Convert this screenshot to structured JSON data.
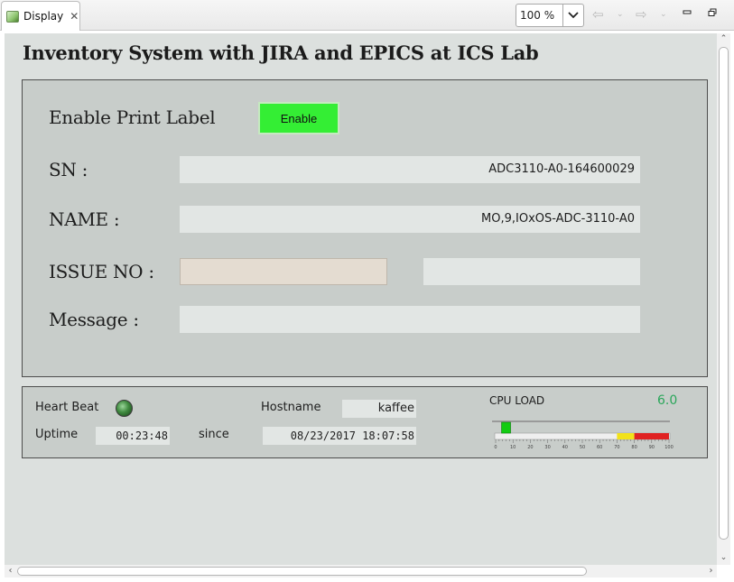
{
  "tab": {
    "title": "Display"
  },
  "toolbar": {
    "zoom": "100 %"
  },
  "display": {
    "title": "Inventory System with JIRA and EPICS at ICS Lab",
    "enable_print_label": "Enable Print Label",
    "enable_button": "Enable",
    "sn_label": "SN :",
    "sn_value": "ADC3110-A0-164600029",
    "name_label": "NAME :",
    "name_value": "MO,9,IOxOS-ADC-3110-A0",
    "issue_label": "ISSUE NO :",
    "issue_input_value": "",
    "issue_value": "",
    "message_label": "Message :",
    "message_value": ""
  },
  "status": {
    "heartbeat_label": "Heart Beat",
    "hostname_label": "Hostname",
    "hostname_value": "kaffee",
    "uptime_label": "Uptime",
    "uptime_value": "00:23:48",
    "since_label": "since",
    "since_value": "08/23/2017 18:07:58",
    "cpu_label": "CPU LOAD",
    "cpu_value": "6.0",
    "cpu_load_percent": 6.0,
    "cpu_scale": [
      "0",
      "10",
      "20",
      "30",
      "40",
      "50",
      "60",
      "70",
      "80",
      "90",
      "100"
    ],
    "colors": {
      "led": "#2f8a2f",
      "cpu_text": "#2aa65a",
      "warn_zone": "#f2e21a",
      "alarm_zone": "#e02222",
      "indicator": "#12cc12"
    }
  }
}
